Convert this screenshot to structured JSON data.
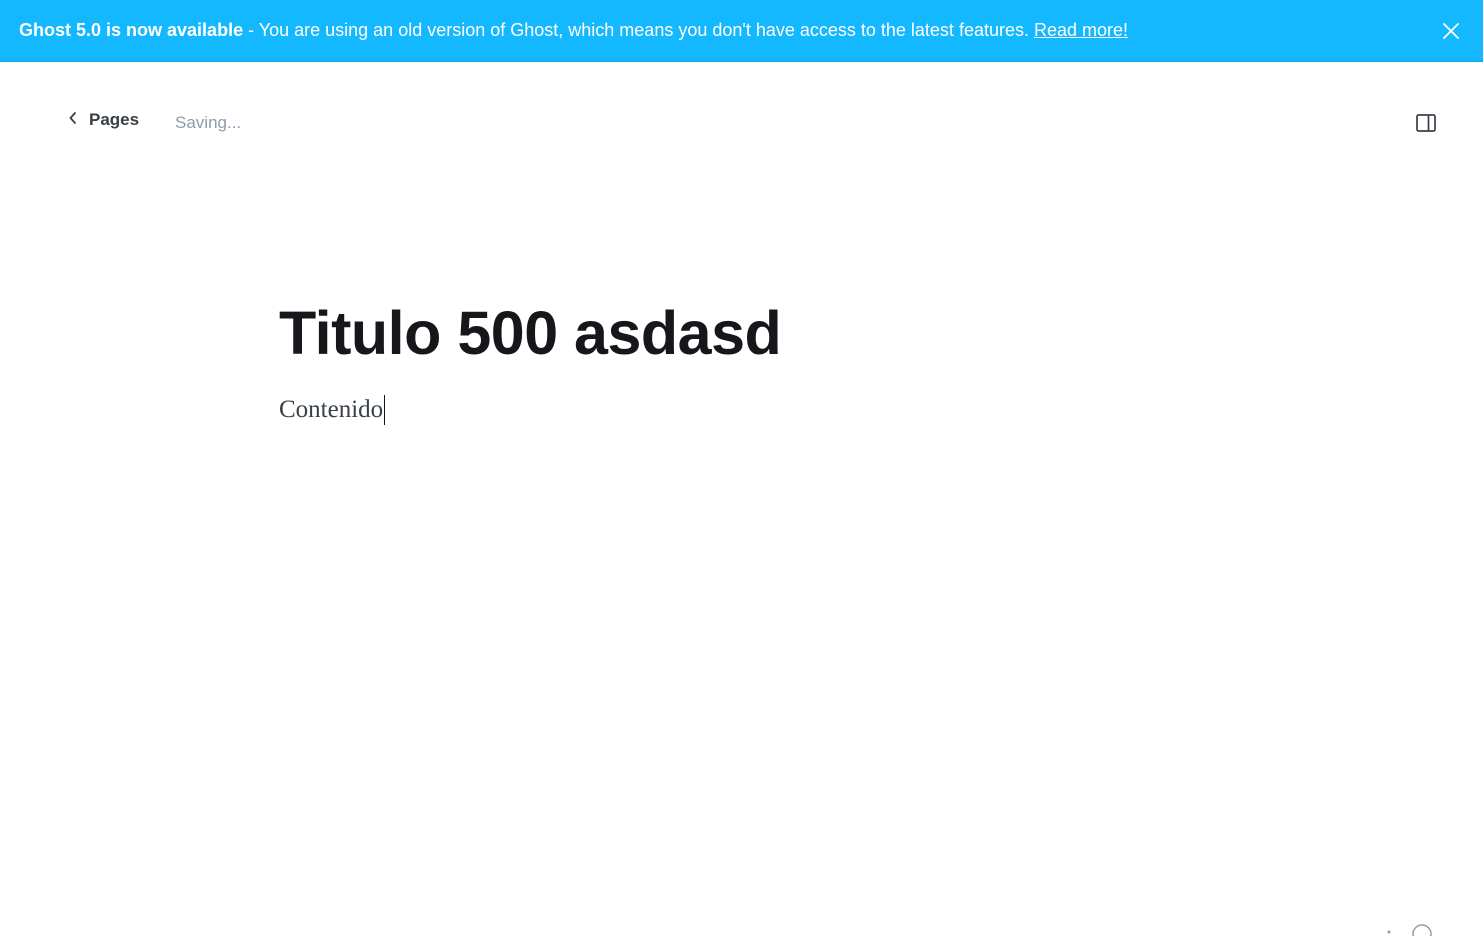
{
  "banner": {
    "headline": "Ghost 5.0 is now available",
    "message": " - You are using an old version of Ghost, which means you don't have access to the latest features. ",
    "link_label": "Read more!",
    "background_color": "#14b8ff",
    "close_icon": "close-icon"
  },
  "header": {
    "back_label": "Pages",
    "back_icon": "chevron-left-icon",
    "status_text": "Saving...",
    "sidebar_toggle_icon": "sidebar-toggle-icon"
  },
  "editor": {
    "title": "Titulo 500 asdasd",
    "body": "Contenido"
  }
}
